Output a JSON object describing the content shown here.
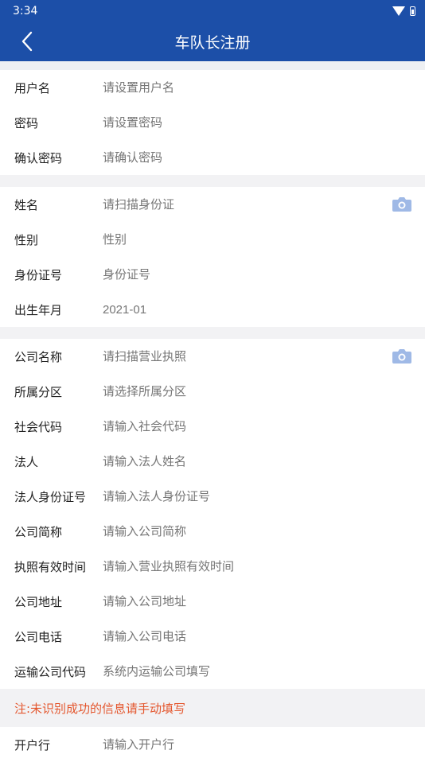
{
  "status": {
    "time": "3:34"
  },
  "header": {
    "title": "车队长注册"
  },
  "account": [
    {
      "label": "用户名",
      "placeholder": "请设置用户名"
    },
    {
      "label": "密码",
      "placeholder": "请设置密码"
    },
    {
      "label": "确认密码",
      "placeholder": "请确认密码"
    }
  ],
  "identity": [
    {
      "label": "姓名",
      "placeholder": "请扫描身份证"
    },
    {
      "label": "性别",
      "placeholder": "性别"
    },
    {
      "label": "身份证号",
      "placeholder": "身份证号"
    },
    {
      "label": "出生年月",
      "placeholder": "2021-01"
    }
  ],
  "company": [
    {
      "label": "公司名称",
      "placeholder": "请扫描营业执照"
    },
    {
      "label": "所属分区",
      "placeholder": "请选择所属分区"
    },
    {
      "label": "社会代码",
      "placeholder": "请输入社会代码"
    },
    {
      "label": "法人",
      "placeholder": "请输入法人姓名"
    },
    {
      "label": "法人身份证号",
      "placeholder": "请输入法人身份证号"
    },
    {
      "label": "公司简称",
      "placeholder": "请输入公司简称"
    },
    {
      "label": "执照有效时间",
      "placeholder": "请输入营业执照有效时间"
    },
    {
      "label": "公司地址",
      "placeholder": "请输入公司地址"
    },
    {
      "label": "公司电话",
      "placeholder": "请输入公司电话"
    },
    {
      "label": "运输公司代码",
      "placeholder": "系统内运输公司填写"
    }
  ],
  "note": "注:未识别成功的信息请手动填写",
  "bank": [
    {
      "label": "开户行",
      "placeholder": "请输入开户行"
    }
  ],
  "colors": {
    "primary": "#1c4fa8",
    "note": "#e4572e",
    "camera": "#9fb9e6"
  }
}
